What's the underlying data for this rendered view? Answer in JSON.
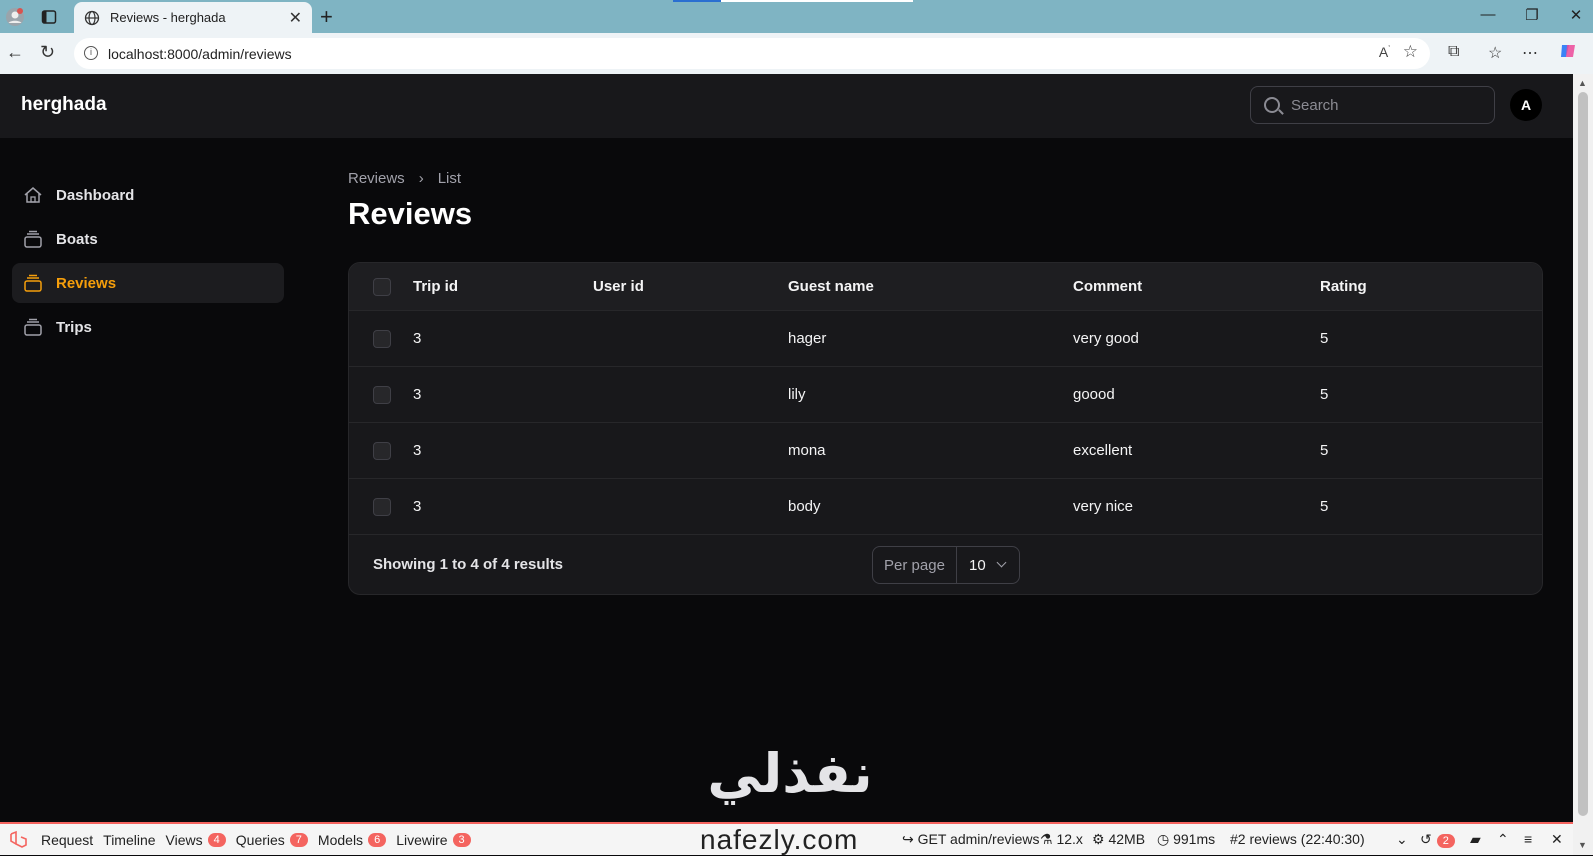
{
  "browser": {
    "tab_title": "Reviews - herghada",
    "url": "localhost:8000/admin/reviews"
  },
  "app": {
    "brand": "herghada",
    "search_placeholder": "Search",
    "avatar_initial": "A"
  },
  "sidebar": {
    "items": [
      {
        "label": "Dashboard",
        "icon": "home-icon"
      },
      {
        "label": "Boats",
        "icon": "rectangle-stack-icon"
      },
      {
        "label": "Reviews",
        "icon": "rectangle-stack-icon",
        "active": true
      },
      {
        "label": "Trips",
        "icon": "rectangle-stack-icon"
      }
    ]
  },
  "breadcrumb": [
    "Reviews",
    "List"
  ],
  "page_title": "Reviews",
  "table": {
    "columns": [
      "Trip id",
      "User id",
      "Guest name",
      "Comment",
      "Rating"
    ],
    "rows": [
      {
        "trip_id": "3",
        "user_id": "",
        "guest_name": "hager",
        "comment": "very good",
        "rating": "5"
      },
      {
        "trip_id": "3",
        "user_id": "",
        "guest_name": "lily",
        "comment": "goood",
        "rating": "5"
      },
      {
        "trip_id": "3",
        "user_id": "",
        "guest_name": "mona",
        "comment": "excellent",
        "rating": "5"
      },
      {
        "trip_id": "3",
        "user_id": "",
        "guest_name": "body",
        "comment": "very nice",
        "rating": "5"
      }
    ],
    "showing": "Showing 1 to 4 of 4 results",
    "per_page_label": "Per page",
    "per_page_value": "10"
  },
  "watermark": {
    "arabic": "نفذلي",
    "latin": "nafezly.com"
  },
  "debugbar": {
    "items": [
      {
        "label": "Request"
      },
      {
        "label": "Timeline"
      },
      {
        "label": "Views",
        "badge": "4"
      },
      {
        "label": "Queries",
        "badge": "7"
      },
      {
        "label": "Models",
        "badge": "6"
      },
      {
        "label": "Livewire",
        "badge": "3"
      }
    ],
    "route": "GET admin/reviews",
    "version": "12.x",
    "memory": "42MB",
    "time": "991ms",
    "request": "#2 reviews (22:40:30)",
    "history_badge": "2"
  },
  "colors": {
    "accent": "#f59e0b",
    "background": "#09090b",
    "panel": "#18181b",
    "debug_red": "#f4645f"
  }
}
